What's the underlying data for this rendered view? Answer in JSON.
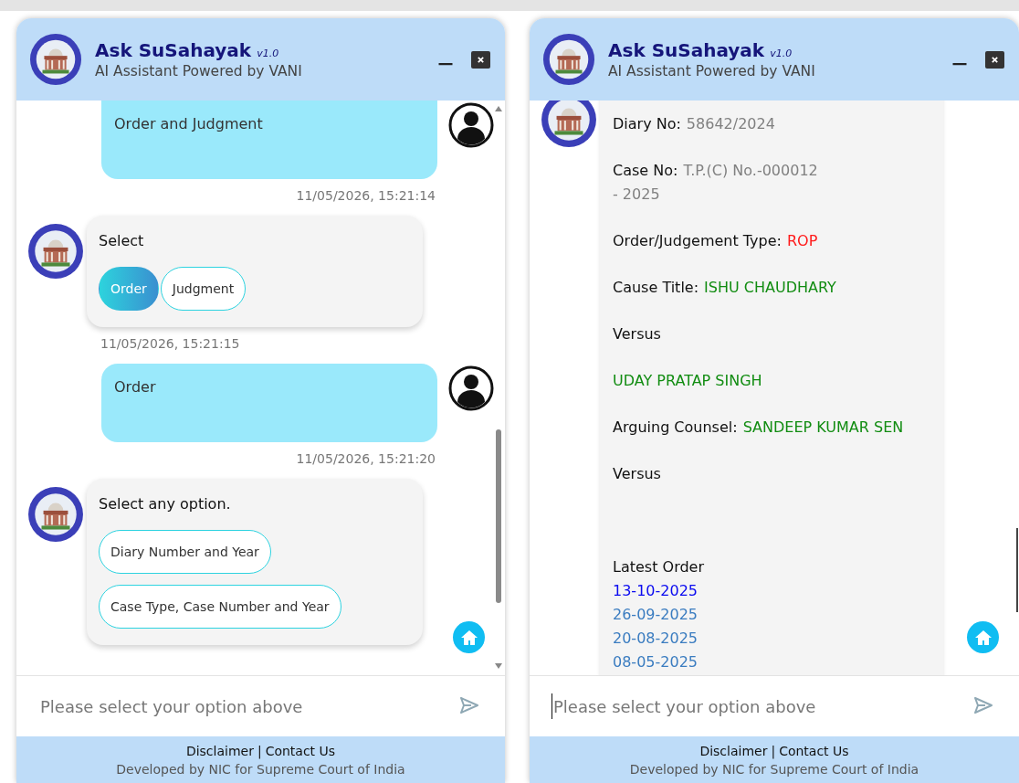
{
  "panels": [
    {
      "header": {
        "title": "Ask SuSahayak",
        "version": "v1.0",
        "subtitle": "AI Assistant Powered by VANI"
      },
      "messages": [
        {
          "kind": "user",
          "text": "Order and Judgment",
          "time": "11/05/2026, 15:21:14"
        },
        {
          "kind": "bot",
          "text": "Select",
          "choices": {
            "kind": "row",
            "options": [
              {
                "label": "Order",
                "selected": true
              },
              {
                "label": "Judgment",
                "selected": false
              }
            ]
          },
          "time": "11/05/2026, 15:21:15"
        },
        {
          "kind": "user",
          "text": "Order",
          "time": "11/05/2026, 15:21:20"
        },
        {
          "kind": "bot",
          "text": "Select any option.",
          "choices": {
            "kind": "column",
            "options": [
              {
                "label": "Diary Number and Year",
                "selected": false
              },
              {
                "label": "Case Type, Case Number and Year",
                "selected": false
              }
            ]
          }
        }
      ],
      "scrollbar": {
        "kind": "arrows"
      },
      "input": {
        "placeholder": "Please select your option above",
        "focused": false
      },
      "footer": {
        "links": [
          "Disclaimer",
          "Contact Us"
        ],
        "separator": "|",
        "credit": "Developed by NIC for Supreme Court of India"
      }
    },
    {
      "header": {
        "title": "Ask SuSahayak",
        "version": "v1.0",
        "subtitle": "AI Assistant Powered by VANI"
      },
      "messages": [
        {
          "kind": "details",
          "lines": [
            {
              "label": "Diary No:",
              "value": "58642/2024",
              "color": "#808080"
            },
            {
              "label": "Case No:",
              "value": "T.P.(C) No.-000012\n- 2025",
              "color": "#808080"
            },
            {
              "label": "Order/Judgement Type:",
              "value": "ROP",
              "color": "#ff1a1a"
            },
            {
              "label": "Cause Title:",
              "value": "ISHU CHAUDHARY",
              "color": "#118c11"
            },
            {
              "label": "Versus"
            },
            {
              "value": "UDAY PRATAP SINGH",
              "color": "#118c11"
            },
            {
              "label": "Arguing Counsel:",
              "value": "SANDEEP KUMAR SEN",
              "color": "#118c11"
            },
            {
              "label": "Versus"
            }
          ],
          "latest_label": "Latest Order",
          "dates": [
            {
              "text": "13-10-2025",
              "color": "#0a0af0"
            },
            {
              "text": "26-09-2025",
              "color": "#3a7cc0"
            },
            {
              "text": "20-08-2025",
              "color": "#3a7cc0"
            },
            {
              "text": "08-05-2025",
              "color": "#3a7cc0"
            }
          ]
        }
      ],
      "scrollbar": {
        "kind": "thin"
      },
      "input": {
        "placeholder": "Please select your option above",
        "focused": true
      },
      "footer": {
        "links": [
          "Disclaimer",
          "Contact Us"
        ],
        "separator": "|",
        "credit": "Developed by NIC for Supreme Court of India"
      }
    }
  ]
}
